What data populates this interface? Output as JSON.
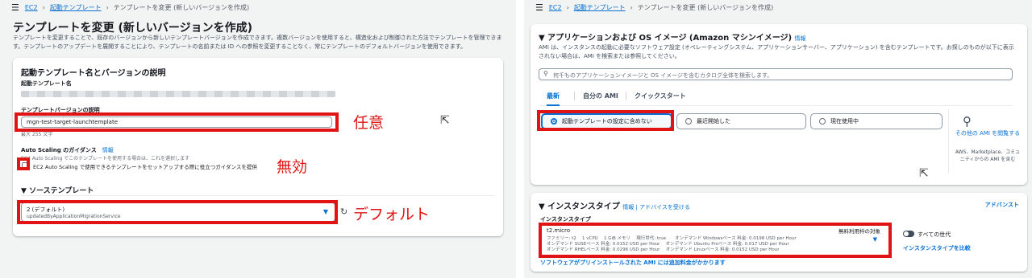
{
  "left": {
    "breadcrumb": {
      "root": "EC2",
      "parent": "起動テンプレート",
      "current": "テンプレートを変更 (新しいバージョンを作成)"
    },
    "title": "テンプレートを変更 (新しいバージョンを作成)",
    "description": "テンプレートを変更することで、既存のバージョンから新しいテンプレートバージョンを作成できます。複数バージョンを使用すると、構造化および制御された方法でテンプレートを管理できます。テンプレートのアップデートを展開することにより、テンプレートの名前または ID への参照を変更することなく、常にテンプレートのデフォルトバージョンを使用できます。",
    "card": {
      "heading": "起動テンプレート名とバージョンの説明",
      "name_label": "起動テンプレート名",
      "version_desc_label": "テンプレートバージョンの説明",
      "version_desc_value": "mgn-test-target-launchtemplate",
      "max_hint": "最大 255 文字",
      "asg_label": "Auto Scaling のガイダンス",
      "info": "情報",
      "asg_hint": "EC2 Auto Scaling でこのテンプレートを使用する場合は、これを選択します",
      "asg_checkbox_label": "EC2 Auto Scaling で使用できるテンプレートをセットアップする際に役立つガイダンスを提供",
      "source_heading": "ソーステンプレート",
      "source_value": "2 (デフォルト)",
      "source_sub": "updatedByApplicationMigrationService"
    },
    "annotations": {
      "desc": "任意",
      "asg": "無効",
      "source": "デフォルト"
    }
  },
  "right": {
    "breadcrumb": {
      "root": "EC2",
      "parent": "起動テンプレート",
      "current": "テンプレートを変更 (新しいバージョンを作成)"
    },
    "ami": {
      "heading": "アプリケーションおよび OS イメージ (Amazon マシンイメージ)",
      "info": "情報",
      "description": "AMI は、インスタンスの起動に必要なソフトウェア設定 (オペレーティングシステム、アプリケーションサーバー、アプリケーション) を含むテンプレートです。お探しのものが以下に表示されない場合は、AMI を検索または参照してください。",
      "search_placeholder": "何千ものアプリケーションイメージと OS イメージを含むカタログ全体を検索します。",
      "tabs": [
        "最新",
        "自分の AMI",
        "クイックスタート"
      ],
      "options": [
        "起動テンプレートの設定に含めない",
        "最近開始した",
        "現在使用中"
      ],
      "browse_label": "その他の AMI を閲覧する",
      "browse_sub": "AWS、Marketplace、コミュニティからの AMI を含む"
    },
    "instance": {
      "heading": "インスタンスタイプ",
      "info": "情報",
      "advice": "アドバイスを受ける",
      "advanced": "アドバンスト",
      "label": "インスタンスタイプ",
      "type_name": "t2.micro",
      "free_tier": "無料利用枠の対象",
      "spec_line1": "ファミリー: t2　 1 vCPU　 1 GiB メモリ　 現行世代: true　　オンデマンド Windowsベース 料金: 0.0198 USD per Hour",
      "spec_line2": "オンデマンド SUSEベース 料金: 0.0152 USD per Hour　 オンデマンド Ubuntu Proベース 料金: 0.017 USD per Hour",
      "spec_line3": "オンデマンド RHELベース 料金: 0.0296 USD per Hour　 オンデマンド Linuxベース 料金: 0.0152 USD per Hour",
      "all_gen_label": "すべての世代",
      "compare_link": "インスタンスタイプを比較",
      "footer_note": "ソフトウェアがプリインストールされた AMI には追加料金がかかります"
    }
  },
  "colors": {
    "accent": "#0972d3",
    "annotation": "#e01414",
    "background": "#f2f3f3"
  }
}
